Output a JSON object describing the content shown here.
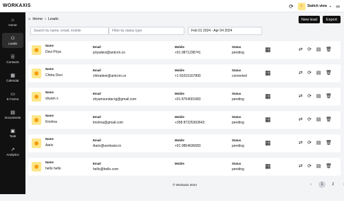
{
  "app": {
    "logo": "WORKAXIS"
  },
  "header": {
    "switch_view": "Switch view",
    "switch_avatar": "☺"
  },
  "sidebar": {
    "items": [
      {
        "label": "Home",
        "icon": "⌂"
      },
      {
        "label": "Leads",
        "icon": "⚇"
      },
      {
        "label": "Contacts",
        "icon": "☰"
      },
      {
        "label": "Calendar",
        "icon": "▦"
      },
      {
        "label": "E Forms",
        "icon": "▭"
      },
      {
        "label": "Documents",
        "icon": "▤"
      },
      {
        "label": "Task",
        "icon": "▣"
      },
      {
        "label": "Analytics",
        "icon": "↗"
      }
    ],
    "collapse": "‹"
  },
  "breadcrumb": {
    "home": "Home",
    "sep": "›",
    "current": "Leads"
  },
  "toolbar": {
    "new_lead": "New lead",
    "export": "Export"
  },
  "filters": {
    "search_placeholder": "Search by name, email, mobile",
    "status_placeholder": "Filter by status type",
    "date_range": "Feb 01 2024 - Apr 04 2024"
  },
  "labels": {
    "name": "Name",
    "email": "Email",
    "mobile": "Mobile",
    "status": "Status"
  },
  "leads": [
    {
      "name": "Devi Priya",
      "email": "priyadevi@antcrm.co",
      "mobile": "+91 9871238741",
      "status": "pending"
    },
    {
      "name": "Chitra Devi",
      "email": "chitradevi@antcrm.co",
      "mobile": "+1 81015167890",
      "status": "converted"
    },
    {
      "name": "shyam s",
      "email": "shyamsundar.tg@gmail.com",
      "mobile": "+91 8754001683",
      "status": "pending"
    },
    {
      "name": "Krishna",
      "email": "krishna@gmail.com",
      "mobile": "+358 87225363643",
      "status": "pending"
    },
    {
      "name": "Aariv",
      "email": "Aariv@workaxis.in",
      "mobile": "+91 9854636683",
      "status": "pending"
    },
    {
      "name": "hello hello",
      "email": "hello@hello.com",
      "mobile": "",
      "status": "pending"
    }
  ],
  "footer": {
    "copyright": "© Workaxis 2024"
  },
  "pagination": {
    "prev": "‹",
    "pages": [
      "1",
      "2"
    ],
    "next": "›",
    "current": "1"
  }
}
